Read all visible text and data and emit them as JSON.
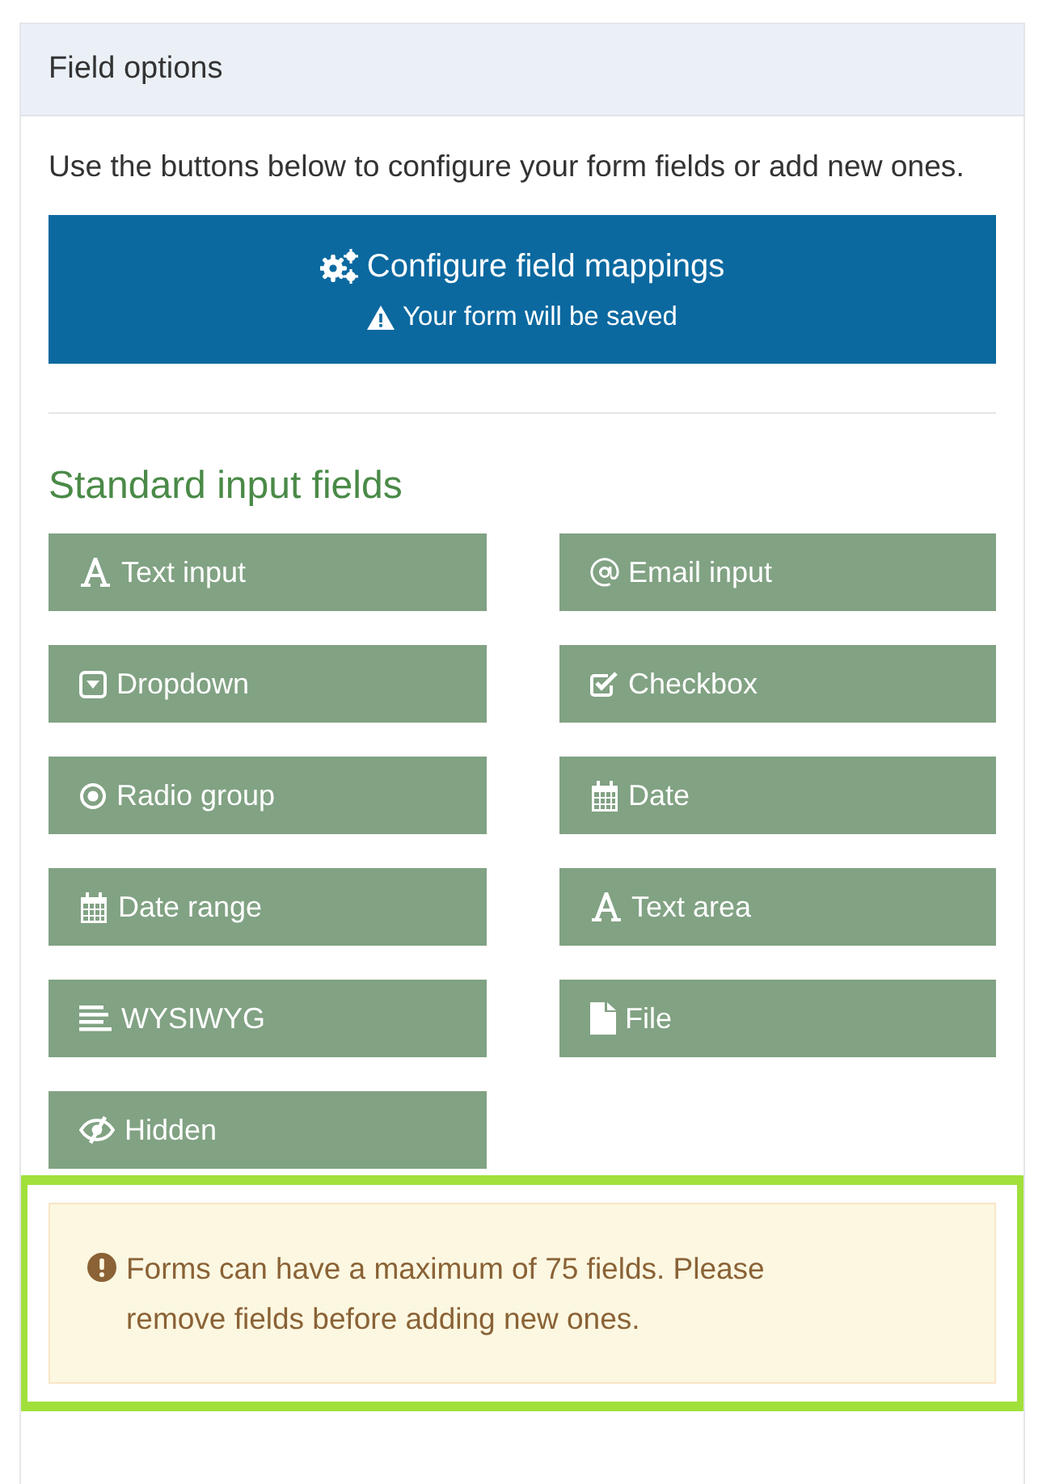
{
  "panel": {
    "title": "Field options"
  },
  "intro": "Use the buttons below to configure your form fields or add new ones.",
  "configure_button": {
    "label": "Configure field mappings",
    "note": "Your form will be saved"
  },
  "section_title": "Standard input fields",
  "field_buttons": [
    {
      "label": "Text input",
      "kind": "text"
    },
    {
      "label": "Email input",
      "kind": "email"
    },
    {
      "label": "Dropdown",
      "kind": "dropdown"
    },
    {
      "label": "Checkbox",
      "kind": "checkbox"
    },
    {
      "label": "Radio group",
      "kind": "radio"
    },
    {
      "label": "Date",
      "kind": "date"
    },
    {
      "label": "Date range",
      "kind": "date"
    },
    {
      "label": "Text area",
      "kind": "text"
    },
    {
      "label": "WYSIWYG",
      "kind": "wysiwyg"
    },
    {
      "label": "File",
      "kind": "file"
    },
    {
      "label": "Hidden",
      "kind": "hidden"
    }
  ],
  "alert": {
    "text": "Forms can have a maximum of 75 fields. Please remove fields before adding new ones.",
    "highlighted": true
  }
}
